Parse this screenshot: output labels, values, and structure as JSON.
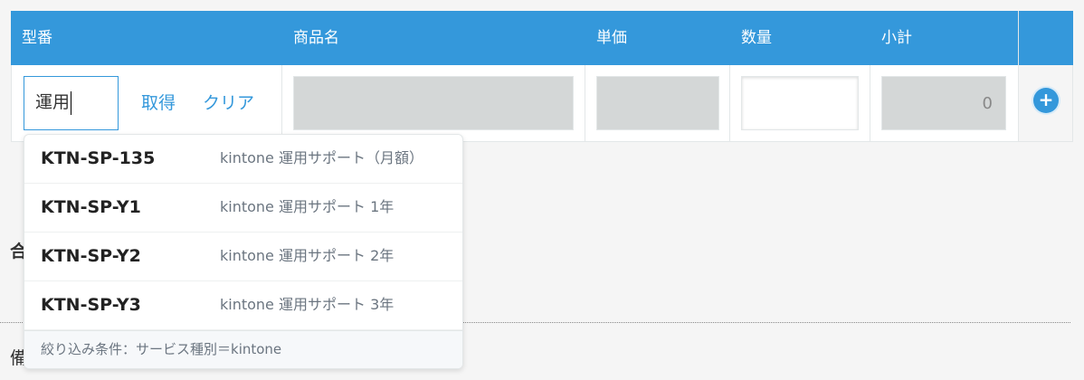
{
  "table": {
    "headers": {
      "model": "型番",
      "product_name": "商品名",
      "unit_price": "単価",
      "quantity": "数量",
      "subtotal": "小計"
    },
    "row": {
      "model_value": "運用",
      "fetch_label": "取得",
      "clear_label": "クリア",
      "subtotal_value": "0",
      "add_icon": "+"
    }
  },
  "background_labels": {
    "total_partial": "合",
    "notes_partial": "備"
  },
  "dropdown": {
    "items": [
      {
        "code": "KTN-SP-135",
        "name": "kintone 運用サポート（月額）"
      },
      {
        "code": "KTN-SP-Y1",
        "name": "kintone 運用サポート 1年"
      },
      {
        "code": "KTN-SP-Y2",
        "name": "kintone 運用サポート 2年"
      },
      {
        "code": "KTN-SP-Y3",
        "name": "kintone 運用サポート 3年"
      }
    ],
    "footer": "絞り込み条件：サービス種別＝kintone"
  },
  "colors": {
    "accent": "#3498db",
    "readonly_field": "#d4d7d7",
    "background": "#f5f5f5"
  }
}
